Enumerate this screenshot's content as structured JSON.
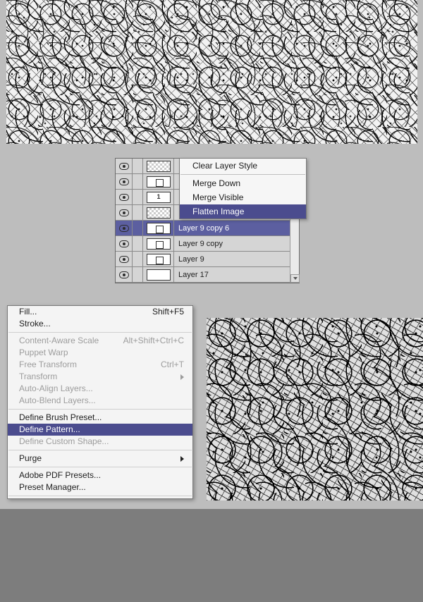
{
  "layers": {
    "rows": [
      {
        "name": "",
        "thumb": "checker",
        "eye": true
      },
      {
        "name": "",
        "thumb": "bar",
        "eye": true
      },
      {
        "name": "",
        "thumb": "one",
        "eye": true
      },
      {
        "name": "",
        "thumb": "checker",
        "eye": true
      },
      {
        "name": "Layer 9 copy 6",
        "thumb": "bar",
        "eye": true,
        "selected": true
      },
      {
        "name": "Layer 9 copy",
        "thumb": "bar",
        "eye": true
      },
      {
        "name": "Layer 9",
        "thumb": "bar",
        "eye": true
      },
      {
        "name": "Layer 17",
        "thumb": "white",
        "eye": true
      }
    ]
  },
  "ctx_small": {
    "clear_style": "Clear Layer Style",
    "merge_down": "Merge Down",
    "merge_visible": "Merge Visible",
    "flatten": "Flatten Image"
  },
  "ctx_big": {
    "fill": {
      "label": "Fill...",
      "shortcut": "Shift+F5"
    },
    "stroke": {
      "label": "Stroke..."
    },
    "cas": {
      "label": "Content-Aware Scale",
      "shortcut": "Alt+Shift+Ctrl+C"
    },
    "puppet": {
      "label": "Puppet Warp"
    },
    "free_tx": {
      "label": "Free Transform",
      "shortcut": "Ctrl+T"
    },
    "transform": {
      "label": "Transform"
    },
    "auto_align": {
      "label": "Auto-Align Layers..."
    },
    "auto_blend": {
      "label": "Auto-Blend Layers..."
    },
    "def_brush": {
      "label": "Define Brush Preset..."
    },
    "def_pattern": {
      "label": "Define Pattern..."
    },
    "def_shape": {
      "label": "Define Custom Shape..."
    },
    "purge": {
      "label": "Purge"
    },
    "pdf": {
      "label": "Adobe PDF Presets..."
    },
    "preset_mgr": {
      "label": "Preset Manager..."
    }
  }
}
